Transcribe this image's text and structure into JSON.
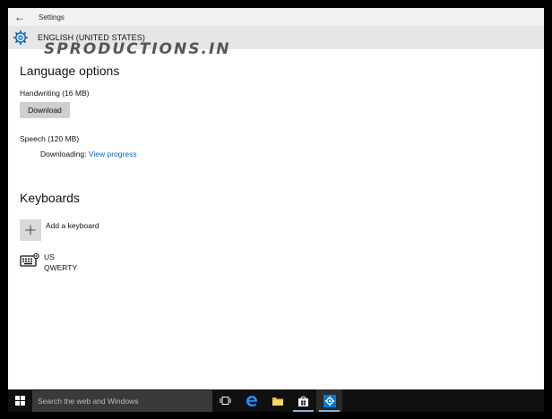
{
  "titlebar": {
    "back_glyph": "←",
    "title": "Settings"
  },
  "header": {
    "icon": "gear-icon",
    "language": "ENGLISH (UNITED STATES)"
  },
  "watermark": "SPRODUCTIONS.IN",
  "language_options": {
    "title": "Language options",
    "handwriting": {
      "label": "Handwriting (16 MB)",
      "button": "Download"
    },
    "speech": {
      "label": "Speech (120 MB)",
      "status_label": "Downloading:",
      "progress_link": "View progress"
    }
  },
  "keyboards": {
    "title": "Keyboards",
    "add_label": "Add a keyboard",
    "items": [
      {
        "name": "US",
        "layout": "QWERTY",
        "icon": "keyboard-icon"
      }
    ]
  },
  "taskbar": {
    "search_placeholder": "Search the web and Windows",
    "icons": [
      "windows-start-icon",
      "task-view-icon",
      "edge-icon",
      "file-explorer-icon",
      "store-icon",
      "settings-icon"
    ]
  },
  "colors": {
    "accent": "#0067c0",
    "header_bg": "#e6e6e6",
    "taskbar_bg": "#101010",
    "settings_icon_bg": "#0078d7"
  }
}
